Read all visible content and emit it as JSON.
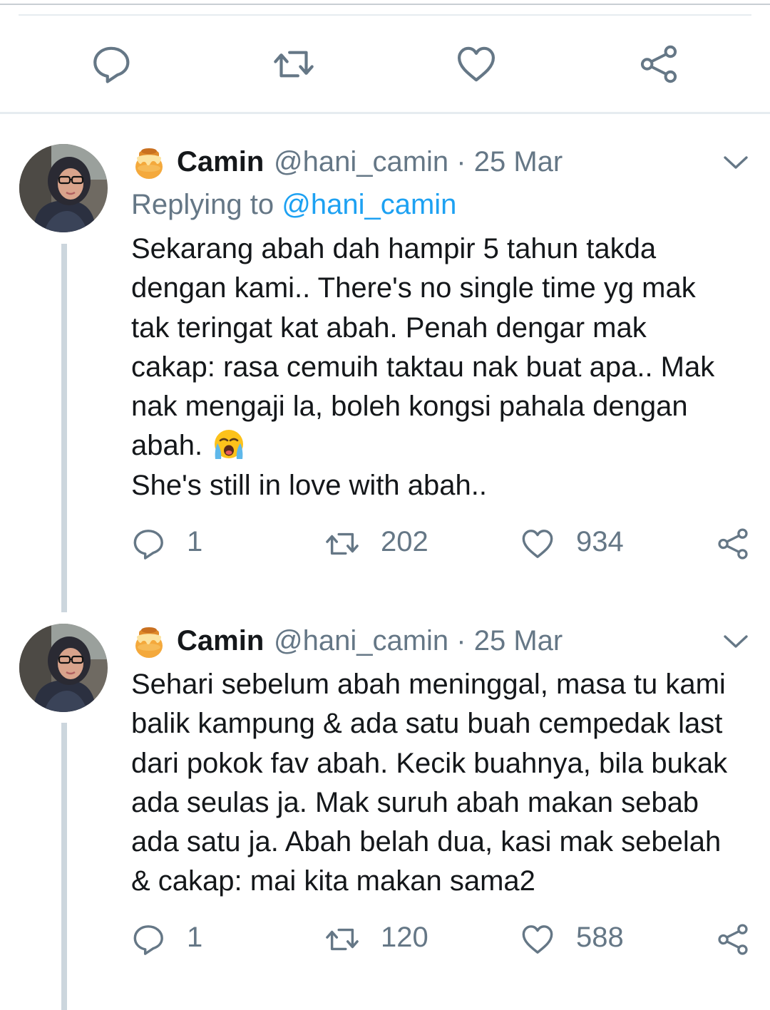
{
  "colors": {
    "icon_gray": "#657786",
    "link_blue": "#1da1f2",
    "thread_line": "#ccd6dd",
    "text": "#14171a"
  },
  "action_bar": {
    "icons": [
      "reply-icon",
      "retweet-icon",
      "like-icon",
      "share-icon"
    ]
  },
  "tweets": [
    {
      "name": "Camin",
      "handle_time": "@hani_camin · 25 Mar",
      "replying_prefix": "Replying to",
      "replying_to": "@hani_camin",
      "text_part1": "Sekarang abah dah hampir 5 tahun  takda\ndengan kami.. There's no single time yg mak\ntak teringat kat abah. Penah dengar mak\ncakap: rasa cemuih taktau nak buat apa.. Mak\nnak mengaji la, boleh kongsi pahala dengan\nabah. ",
      "emoji": "loudly-crying-face",
      "text_part2": "\nShe's still in love with abah..",
      "replies": "1",
      "retweets": "202",
      "likes": "934"
    },
    {
      "name": "Camin",
      "handle_time": "@hani_camin · 25 Mar",
      "text": "Sehari sebelum abah meninggal, masa tu kami\nbalik kampung & ada satu buah cempedak last\ndari pokok fav abah. Kecik buahnya, bila bukak\nada seulas ja. Mak suruh abah makan sebab\nada satu ja. Abah belah dua, kasi mak sebelah\n& cakap: mai kita makan sama2",
      "replies": "1",
      "retweets": "120",
      "likes": "588"
    }
  ]
}
